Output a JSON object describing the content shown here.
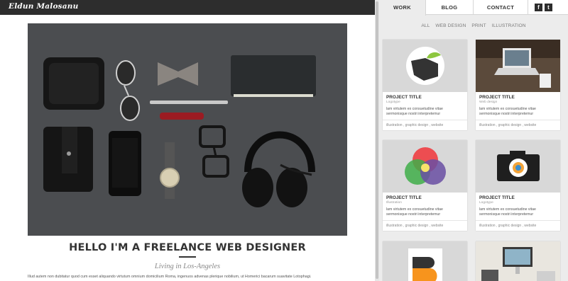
{
  "site": {
    "logo": "Eldun Malosanu"
  },
  "nav": {
    "tabs": [
      {
        "label": "WORK",
        "active": true
      },
      {
        "label": "BLOG",
        "active": false
      },
      {
        "label": "CONTACT",
        "active": false
      }
    ],
    "social": [
      {
        "icon": "facebook-icon",
        "glyph": "f"
      },
      {
        "icon": "twitter-icon",
        "glyph": "t"
      }
    ]
  },
  "filters": [
    "ALL",
    "WEB DESIGN",
    "PRINT",
    "ILLUSTRATION"
  ],
  "hero": {
    "headline": "HELLO I'M A FREELANCE WEB DESIGNER",
    "tagline": "Living in Los-Angeles",
    "bio": "Illud autem non dubitatur quod cum esset aliquando virtutum omnium domicilium Roma, ingenuos advenas plerique nobilium, ut Homerici bacarum suavitate Lotophagi."
  },
  "projects": [
    {
      "title": "PROJECT TITLE",
      "category": "Logotype",
      "desc": "lam virtutem ex consuetudine vitae sermonisque nostri interpretemur",
      "tags": "illustration , graphic design , website"
    },
    {
      "title": "PROJECT TITLE",
      "category": "Web design",
      "desc": "lam virtutem ex consuetudine vitae sermonisque nostri interpretemur",
      "tags": "illustration , graphic design , website"
    },
    {
      "title": "PROJECT TITLE",
      "category": "Illustration",
      "desc": "lam virtutem ex consuetudine vitae sermonisque nostri interpretemur",
      "tags": "illustration , graphic design , website"
    },
    {
      "title": "PROJECT TITLE",
      "category": "Logotype",
      "desc": "lam virtutem ex consuetudine vitae sermonisque nostri interpretemur",
      "tags": "illustration , graphic design , website"
    }
  ],
  "colors": {
    "topbar": "#2d2d2d",
    "panel": "#ececec",
    "accent_green": "#8dc63f"
  }
}
